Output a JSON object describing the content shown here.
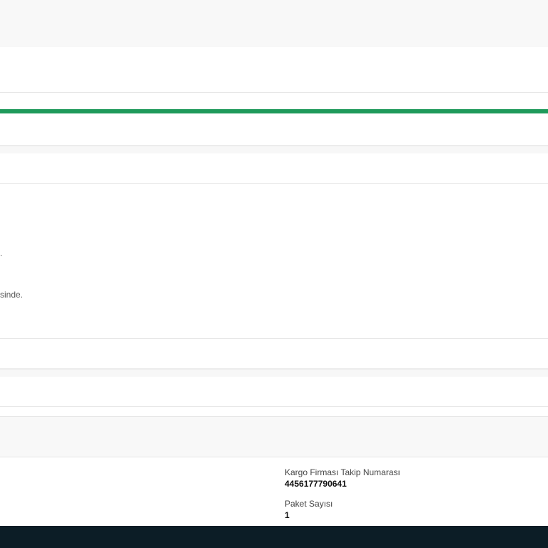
{
  "progress": {
    "fraction": 1.0,
    "color": "#1f9a5b"
  },
  "partial_text": {
    "line_1": ".",
    "line_2": "sinde."
  },
  "shipment": {
    "tracking_label": "Kargo Firması Takip Numarası",
    "tracking_value": "4456177790641",
    "package_count_label": "Paket Sayısı",
    "package_count_value": "1"
  },
  "colors": {
    "bottom_bar": "#0c1d26",
    "top_bar": "#f8f8f8"
  }
}
